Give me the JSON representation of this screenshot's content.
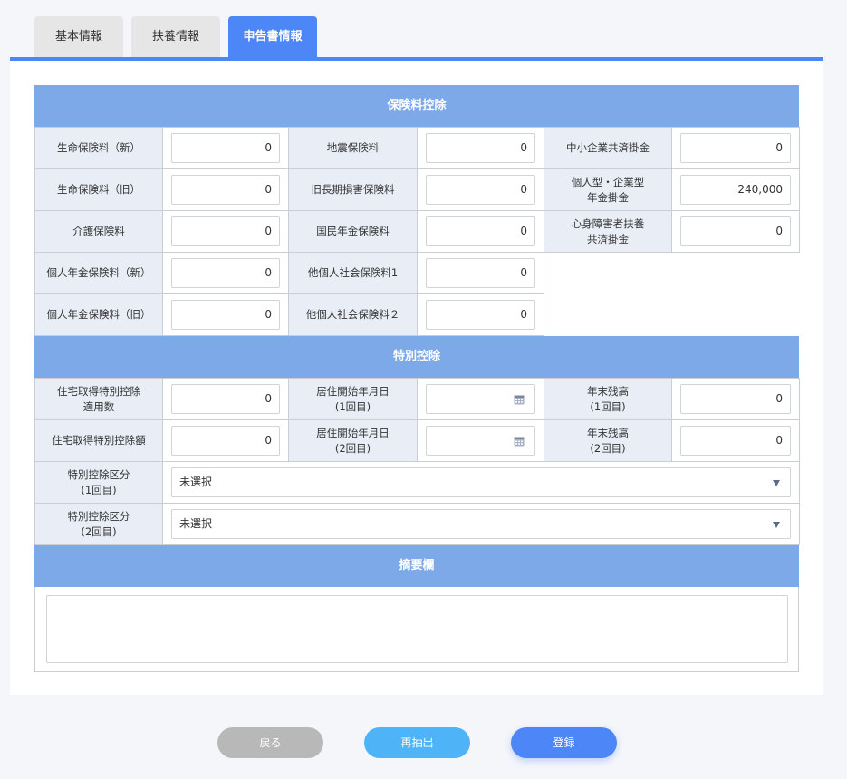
{
  "tabs": [
    {
      "label": "基本情報",
      "active": false
    },
    {
      "label": "扶養情報",
      "active": false
    },
    {
      "label": "申告書情報",
      "active": true
    }
  ],
  "insurance": {
    "title": "保険料控除",
    "rows": [
      [
        {
          "label": "生命保険料（新）",
          "value": "0"
        },
        {
          "label": "地震保険料",
          "value": "0"
        },
        {
          "label": "中小企業共済掛金",
          "value": "0"
        }
      ],
      [
        {
          "label": "生命保険料（旧）",
          "value": "0"
        },
        {
          "label": "旧長期損害保険料",
          "value": "0"
        },
        {
          "label": "個人型・企業型\n年金掛金",
          "value": "240,000"
        }
      ],
      [
        {
          "label": "介護保険料",
          "value": "0"
        },
        {
          "label": "国民年金保険料",
          "value": "0"
        },
        {
          "label": "心身障害者扶養\n共済掛金",
          "value": "0"
        }
      ],
      [
        {
          "label": "個人年金保険料（新）",
          "value": "0"
        },
        {
          "label": "他個人社会保険料1",
          "value": "0"
        }
      ],
      [
        {
          "label": "個人年金保険料（旧）",
          "value": "0"
        },
        {
          "label": "他個人社会保険料２",
          "value": "0"
        }
      ]
    ]
  },
  "special": {
    "title": "特別控除",
    "rows": [
      {
        "c1_label": "住宅取得特別控除\n適用数",
        "c1_value": "0",
        "c2_label": "居住開始年月日\n(1回目)",
        "c2_value": "",
        "c3_label": "年末残高\n(1回目)",
        "c3_value": "0"
      },
      {
        "c1_label": "住宅取得特別控除額",
        "c1_value": "0",
        "c2_label": "居住開始年月日\n(2回目)",
        "c2_value": "",
        "c3_label": "年末残高\n(2回目)",
        "c3_value": "0"
      }
    ],
    "selects": [
      {
        "label": "特別控除区分\n(1回目)",
        "value": "未選択"
      },
      {
        "label": "特別控除区分\n(2回目)",
        "value": "未選択"
      }
    ]
  },
  "memo": {
    "title": "摘要欄",
    "value": ""
  },
  "buttons": {
    "back": {
      "label": "戻る",
      "color": "#b8b8b8"
    },
    "reextract": {
      "label": "再抽出",
      "color": "#4fb4f7"
    },
    "register": {
      "label": "登録",
      "color": "#4d86f7"
    }
  },
  "colors": {
    "accent": "#4d86f7",
    "section_header": "#7ea9e8",
    "label_bg": "#e8edf6"
  }
}
